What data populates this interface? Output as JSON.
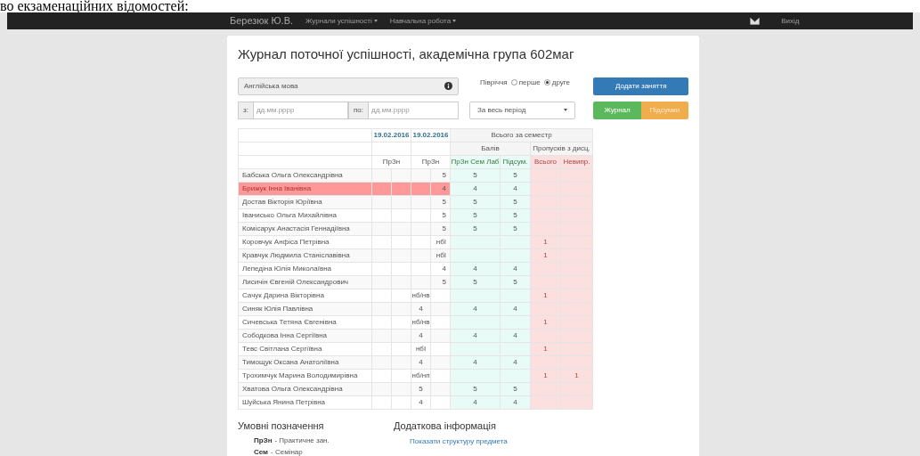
{
  "doc_caption": "во екзаменаційних відомостей:",
  "navbar": {
    "brand": "Березюк Ю.В.",
    "menus": [
      {
        "label": "Журнали успішності"
      },
      {
        "label": "Навчальна робота"
      }
    ],
    "logout": "Вихід"
  },
  "title": "Журнал поточної успішності, академічна група 602маг",
  "subject": {
    "value": "Англійська мова"
  },
  "semester": {
    "label": "Півріччя",
    "options": [
      {
        "label": "перше",
        "selected": false
      },
      {
        "label": "друге",
        "selected": true
      }
    ]
  },
  "add_button": "Додати заняття",
  "date_from": {
    "label": "з:",
    "placeholder": "дд.мм.рррр"
  },
  "date_to": {
    "label": "по:",
    "placeholder": "дд.мм.рррр"
  },
  "period": {
    "value": "За весь період"
  },
  "view_tabs": [
    {
      "label": "Журнал",
      "selected": true
    },
    {
      "label": "Підсумки",
      "selected": false
    }
  ],
  "table": {
    "dates": [
      "19.02.2016",
      "19.02.2016"
    ],
    "lesson_types": [
      "ПрЗн",
      "ПрЗн"
    ],
    "summary_header": "Всього за семестр",
    "points_header": "Балів",
    "absences_header": "Пропусків з дисц.",
    "columns": [
      "ПрЗн Сем Лаб",
      "Підсум.",
      "Всього",
      "Невипр."
    ],
    "rows": [
      {
        "name": "Бабська Ольга Олександрівна",
        "highlighted": false,
        "mark_b": "5",
        "points": "5",
        "final": "5"
      },
      {
        "name": "Брижук Інна Іванівна",
        "highlighted": true,
        "mark_b": "4",
        "points": "4",
        "final": "4"
      },
      {
        "name": "Достав Вікторія Юріївна",
        "highlighted": false,
        "mark_b": "5",
        "points": "5",
        "final": "5"
      },
      {
        "name": "Іванисько Ольга Михайлівна",
        "highlighted": false,
        "mark_b": "5",
        "points": "5",
        "final": "5"
      },
      {
        "name": "Комісарук Анастасія Геннадіївна",
        "highlighted": false,
        "mark_b": "5",
        "points": "5",
        "final": "5"
      },
      {
        "name": "Коровчук Анфіса Петрівна",
        "highlighted": false,
        "mark_b": "нбІ",
        "absent": "1"
      },
      {
        "name": "Кравчук Людмила Станіславівна",
        "highlighted": false,
        "mark_b": "нбІ",
        "absent": "1"
      },
      {
        "name": "Лепедіна Юлія Миколаївна",
        "highlighted": false,
        "mark_b": "4",
        "points": "4",
        "final": "4"
      },
      {
        "name": "Лисичін Євгеній Олександрович",
        "highlighted": false,
        "mark_b": "5",
        "points": "5",
        "final": "5"
      },
      {
        "name": "Сачук Дарина Вікторівна",
        "highlighted": false,
        "mark_a": "нб/нв",
        "absent": "1"
      },
      {
        "name": "Синяк Юлія Павлівна",
        "highlighted": false,
        "mark_a": "4",
        "points": "4",
        "final": "4"
      },
      {
        "name": "Сичевська Тетяна Євгенівна",
        "highlighted": false,
        "mark_a": "нб/нв",
        "absent": "1"
      },
      {
        "name": "Сободкова Інна Сергіївна",
        "highlighted": false,
        "mark_a": "4",
        "points": "4",
        "final": "4"
      },
      {
        "name": "Тевс Світлана Сергіївна",
        "highlighted": false,
        "mark_a": "нбІ",
        "absent": "1"
      },
      {
        "name": "Тимощук Оксана Анатоліївна",
        "highlighted": false,
        "mark_a": "4",
        "points": "4",
        "final": "4"
      },
      {
        "name": "Трохимчук Марина Володимирівна",
        "highlighted": false,
        "mark_a": "нб/нп",
        "absent": "1",
        "unexcused": "1"
      },
      {
        "name": "Хватова Ольга Олександрівна",
        "highlighted": false,
        "mark_a": "5",
        "points": "5",
        "final": "5"
      },
      {
        "name": "Шуйська Янина Петрівна",
        "highlighted": false,
        "mark_a": "4",
        "points": "4",
        "final": "4"
      }
    ]
  },
  "legend": {
    "title": "Умовні позначення",
    "items": [
      {
        "abbr": "ПрЗн",
        "text": "- Практичне зан."
      },
      {
        "abbr": "Сем",
        "text": "- Семінар"
      }
    ]
  },
  "extra_info": {
    "title": "Додаткова інформація",
    "link": "Показати структуру предмета"
  }
}
